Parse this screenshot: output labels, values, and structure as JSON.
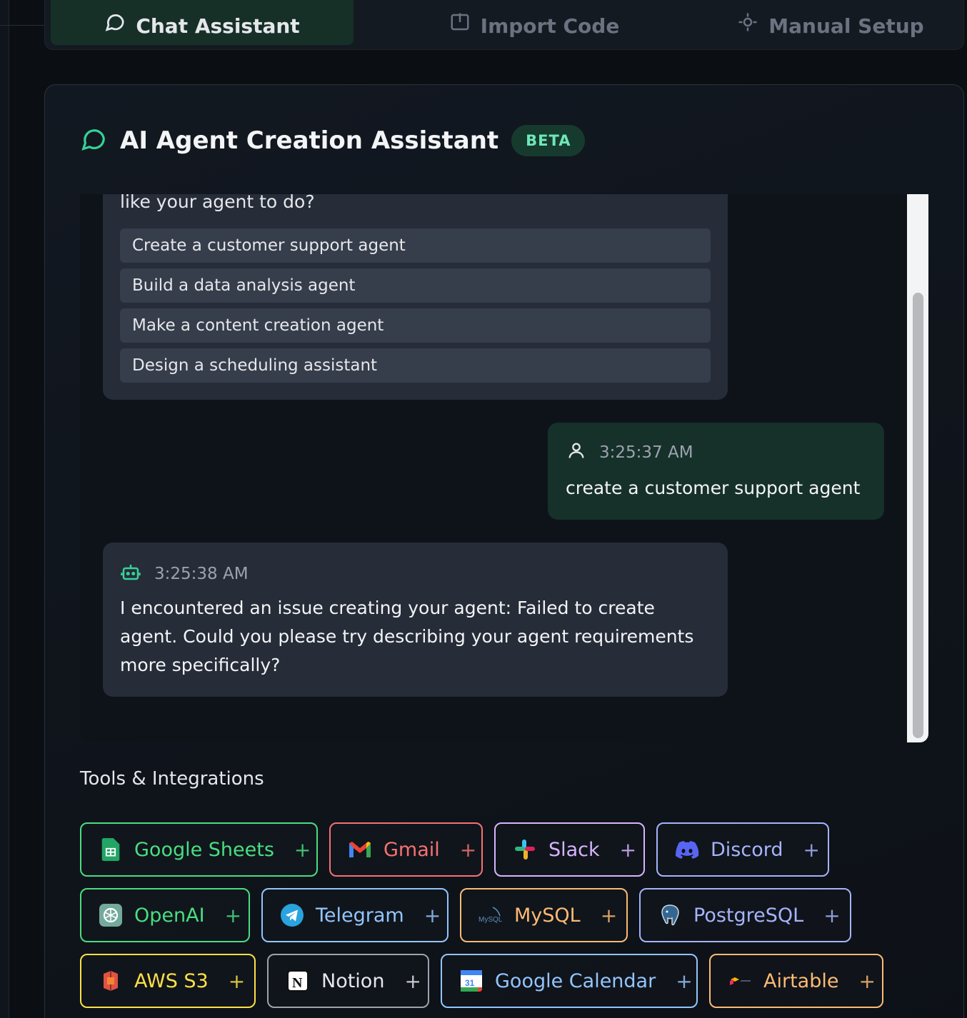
{
  "tabs": [
    {
      "label": "Chat Assistant",
      "icon": "chat-icon",
      "active": true
    },
    {
      "label": "Import Code",
      "icon": "import-icon",
      "active": false
    },
    {
      "label": "Manual Setup",
      "icon": "gear-icon",
      "active": false
    }
  ],
  "header": {
    "title": "AI Agent Creation Assistant",
    "badge": "BETA",
    "icon": "chat-bubble-icon",
    "accent": "#34d399"
  },
  "chat": {
    "intro_text": "like your agent to do?",
    "suggestions": [
      "Create a customer support agent",
      "Build a data analysis agent",
      "Make a content creation agent",
      "Design a scheduling assistant"
    ],
    "user_message": {
      "time": "3:25:37 AM",
      "text": "create a customer support agent",
      "icon": "user-icon"
    },
    "bot_message": {
      "time": "3:25:38 AM",
      "line1": "I encountered an issue creating your agent: Failed to create",
      "line2": "agent. Could you please try describing your agent requirements",
      "line3": "more specifically?",
      "icon": "bot-icon"
    }
  },
  "tools": {
    "title": "Tools & Integrations",
    "add_symbol": "+",
    "items": [
      {
        "label": "Google Sheets",
        "icon": "google-sheets-icon",
        "color": "#4ade80"
      },
      {
        "label": "Gmail",
        "icon": "gmail-icon",
        "color": "#f87171"
      },
      {
        "label": "Slack",
        "icon": "slack-icon",
        "color": "#d8b4fe"
      },
      {
        "label": "Discord",
        "icon": "discord-icon",
        "color": "#a5b4fc"
      },
      {
        "label": "OpenAI",
        "icon": "openai-icon",
        "color": "#4ade80"
      },
      {
        "label": "Telegram",
        "icon": "telegram-icon",
        "color": "#93c5fd"
      },
      {
        "label": "MySQL",
        "icon": "mysql-icon",
        "color": "#fdba74"
      },
      {
        "label": "PostgreSQL",
        "icon": "postgresql-icon",
        "color": "#a5b4fc"
      },
      {
        "label": "AWS S3",
        "icon": "aws-s3-icon",
        "color": "#fde047"
      },
      {
        "label": "Notion",
        "icon": "notion-icon",
        "color": "#e5e7eb"
      },
      {
        "label": "Google Calendar",
        "icon": "google-calendar-icon",
        "color": "#93c5fd"
      },
      {
        "label": "Airtable",
        "icon": "airtable-icon",
        "color": "#fdba74"
      }
    ]
  }
}
